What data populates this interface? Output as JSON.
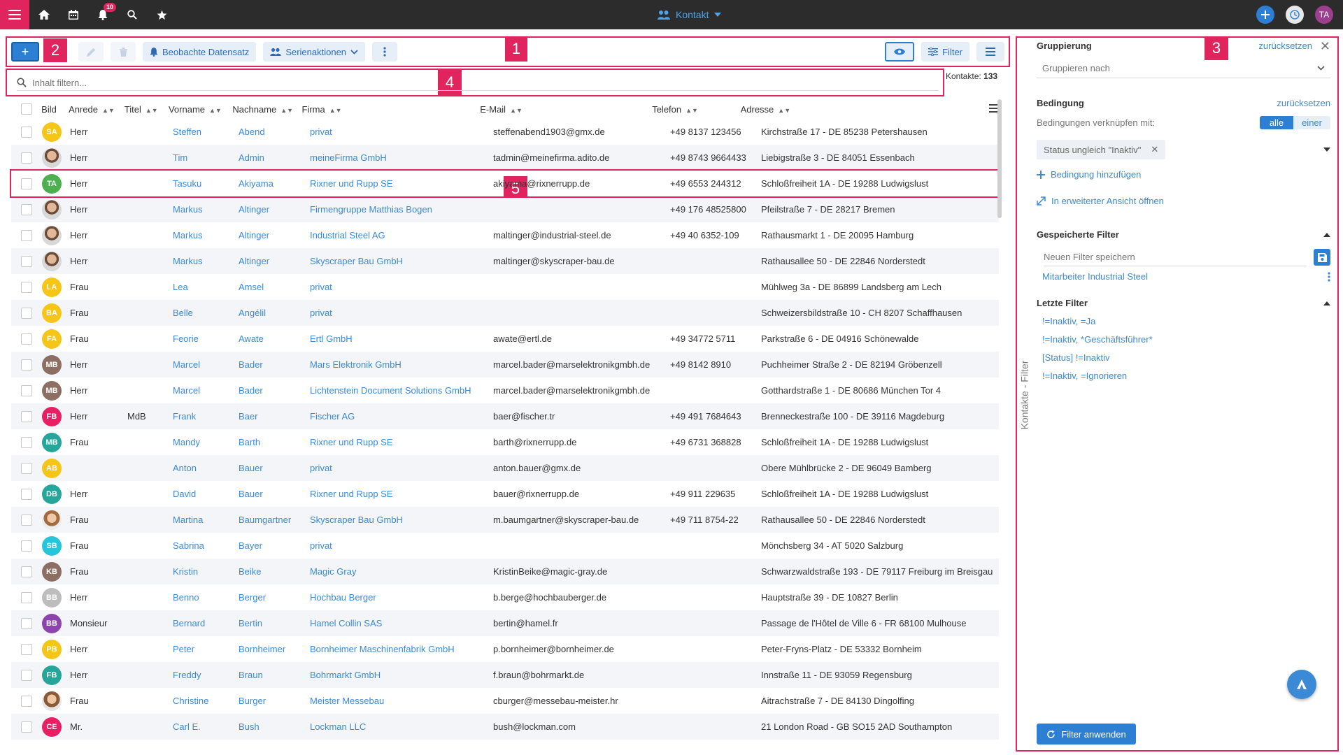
{
  "topbar": {
    "notif_count": "10",
    "title": "Kontakt",
    "user_initials": "TA"
  },
  "toolbar": {
    "add_label": "+",
    "watch_label": "Beobachte Datensatz",
    "series_label": "Serienaktionen",
    "filter_label": "Filter"
  },
  "markers": [
    "1",
    "2",
    "3",
    "4",
    "5"
  ],
  "search": {
    "placeholder": "Inhalt filtern..."
  },
  "count": {
    "label": "Kontakte:",
    "value": "133"
  },
  "table": {
    "headers": [
      "Bild",
      "Anrede",
      "Titel",
      "Vorname",
      "Nachname",
      "Firma",
      "E-Mail",
      "Telefon",
      "Adresse"
    ],
    "rows": [
      {
        "av": "SA",
        "avc": "#f5c518",
        "anrede": "Herr",
        "titel": "",
        "vorname": "Steffen",
        "nachname": "Abend",
        "firma": "privat",
        "email": "steffenabend1903@gmx.de",
        "telefon": "+49 8137 123456",
        "adresse": "Kirchstraße 17 - DE 85238 Petershausen"
      },
      {
        "av": "",
        "avc": "photo",
        "anrede": "Herr",
        "titel": "",
        "vorname": "Tim",
        "nachname": "Admin",
        "firma": "meineFirma GmbH",
        "email": "tadmin@meinefirma.adito.de",
        "telefon": "+49 8743 9664433",
        "adresse": "Liebigstraße 3 - DE 84051 Essenbach"
      },
      {
        "av": "TA",
        "avc": "#4caf50",
        "anrede": "Herr",
        "titel": "",
        "vorname": "Tasuku",
        "nachname": "Akiyama",
        "firma": "Rixner und Rupp SE",
        "email": "akiyama@rixnerrupp.de",
        "telefon": "+49 6553 244312",
        "adresse": "Schloßfreiheit 1A - DE 19288 Ludwigslust"
      },
      {
        "av": "",
        "avc": "photo",
        "anrede": "Herr",
        "titel": "",
        "vorname": "Markus",
        "nachname": "Altinger",
        "firma": "Firmengruppe Matthias Bogen",
        "email": "",
        "telefon": "+49 176 48525800",
        "adresse": "Pfeilstraße 7 - DE 28217 Bremen"
      },
      {
        "av": "",
        "avc": "photo",
        "anrede": "Herr",
        "titel": "",
        "vorname": "Markus",
        "nachname": "Altinger",
        "firma": "Industrial Steel AG",
        "email": "maltinger@industrial-steel.de",
        "telefon": "+49 40 6352-109",
        "adresse": "Rathausmarkt 1 - DE 20095 Hamburg"
      },
      {
        "av": "",
        "avc": "photo",
        "anrede": "Herr",
        "titel": "",
        "vorname": "Markus",
        "nachname": "Altinger",
        "firma": "Skyscraper Bau GmbH",
        "email": "maltinger@skyscraper-bau.de",
        "telefon": "",
        "adresse": "Rathausallee 50 - DE 22846 Norderstedt"
      },
      {
        "av": "LA",
        "avc": "#f5c518",
        "anrede": "Frau",
        "titel": "",
        "vorname": "Lea",
        "nachname": "Amsel",
        "firma": "privat",
        "email": "",
        "telefon": "",
        "adresse": "Mühlweg 3a - DE 86899 Landsberg am Lech"
      },
      {
        "av": "BA",
        "avc": "#f5c518",
        "anrede": "Frau",
        "titel": "",
        "vorname": "Belle",
        "nachname": "Angélil",
        "firma": "privat",
        "email": "",
        "telefon": "",
        "adresse": "Schweizersbildstraße 10 - CH 8207 Schaffhausen"
      },
      {
        "av": "FA",
        "avc": "#f5c518",
        "anrede": "Frau",
        "titel": "",
        "vorname": "Feorie",
        "nachname": "Awate",
        "firma": "Ertl GmbH",
        "email": "awate@ertl.de",
        "telefon": "+49 34772 5711",
        "adresse": "Parkstraße 6 - DE 04916 Schönewalde"
      },
      {
        "av": "MB",
        "avc": "#8d6e63",
        "anrede": "Herr",
        "titel": "",
        "vorname": "Marcel",
        "nachname": "Bader",
        "firma": "Mars Elektronik GmbH",
        "email": "marcel.bader@marselektronikgmbh.de",
        "telefon": "+49 8142 8910",
        "adresse": "Puchheimer Straße 2 - DE 82194 Gröbenzell"
      },
      {
        "av": "MB",
        "avc": "#8d6e63",
        "anrede": "Herr",
        "titel": "",
        "vorname": "Marcel",
        "nachname": "Bader",
        "firma": "Lichtenstein Document Solutions GmbH",
        "email": "marcel.bader@marselektronikgmbh.de",
        "telefon": "",
        "adresse": "Gotthardstraße 1 - DE 80686 München Tor 4"
      },
      {
        "av": "FB",
        "avc": "#e91e63",
        "anrede": "Herr",
        "titel": "MdB",
        "vorname": "Frank",
        "nachname": "Baer",
        "firma": "Fischer AG",
        "email": "baer@fischer.tr",
        "telefon": "+49 491 7684643",
        "adresse": "Brenneckestraße 100 - DE 39116 Magdeburg"
      },
      {
        "av": "MB",
        "avc": "#26a69a",
        "anrede": "Frau",
        "titel": "",
        "vorname": "Mandy",
        "nachname": "Barth",
        "firma": "Rixner und Rupp SE",
        "email": "barth@rixnerrupp.de",
        "telefon": "+49 6731 368828",
        "adresse": "Schloßfreiheit 1A - DE 19288 Ludwigslust"
      },
      {
        "av": "AB",
        "avc": "#f5c518",
        "anrede": "",
        "titel": "",
        "vorname": "Anton",
        "nachname": "Bauer",
        "firma": "privat",
        "email": "anton.bauer@gmx.de",
        "telefon": "",
        "adresse": "Obere Mühlbrücke 2 - DE 96049 Bamberg"
      },
      {
        "av": "DB",
        "avc": "#26a69a",
        "anrede": "Herr",
        "titel": "",
        "vorname": "David",
        "nachname": "Bauer",
        "firma": "Rixner und Rupp SE",
        "email": "bauer@rixnerrupp.de",
        "telefon": "+49 911 229635",
        "adresse": "Schloßfreiheit 1A - DE 19288 Ludwigslust"
      },
      {
        "av": "",
        "avc": "photo2",
        "anrede": "Frau",
        "titel": "",
        "vorname": "Martina",
        "nachname": "Baumgartner",
        "firma": "Skyscraper Bau GmbH",
        "email": "m.baumgartner@skyscraper-bau.de",
        "telefon": "+49 711 8754-22",
        "adresse": "Rathausallee 50 - DE 22846 Norderstedt"
      },
      {
        "av": "SB",
        "avc": "#26c6da",
        "anrede": "Frau",
        "titel": "",
        "vorname": "Sabrina",
        "nachname": "Bayer",
        "firma": "privat",
        "email": "",
        "telefon": "",
        "adresse": "Mönchsberg 34 - AT 5020 Salzburg"
      },
      {
        "av": "KB",
        "avc": "#8d6e63",
        "anrede": "Frau",
        "titel": "",
        "vorname": "Kristin",
        "nachname": "Beike",
        "firma": "Magic Gray",
        "email": "KristinBeike@magic-gray.de",
        "telefon": "",
        "adresse": "Schwarzwaldstraße 193 - DE 79117 Freiburg im Breisgau"
      },
      {
        "av": "BB",
        "avc": "#bdbdbd",
        "anrede": "Herr",
        "titel": "",
        "vorname": "Benno",
        "nachname": "Berger",
        "firma": "Hochbau Berger",
        "email": "b.berge@hochbauberger.de",
        "telefon": "",
        "adresse": "Hauptstraße 39 - DE 10827 Berlin"
      },
      {
        "av": "BB",
        "avc": "#8e44ad",
        "anrede": "Monsieur",
        "titel": "",
        "vorname": "Bernard",
        "nachname": "Bertin",
        "firma": "Hamel Collin SAS",
        "email": "bertin@hamel.fr",
        "telefon": "",
        "adresse": "Passage de l'Hôtel de Ville 6 - FR 68100 Mulhouse"
      },
      {
        "av": "PB",
        "avc": "#f5c518",
        "anrede": "Herr",
        "titel": "",
        "vorname": "Peter",
        "nachname": "Bornheimer",
        "firma": "Bornheimer Maschinenfabrik GmbH",
        "email": "p.bornheimer@bornheimer.de",
        "telefon": "",
        "adresse": "Peter-Fryns-Platz - DE 53332 Bornheim"
      },
      {
        "av": "FB",
        "avc": "#26a69a",
        "anrede": "Herr",
        "titel": "",
        "vorname": "Freddy",
        "nachname": "Braun",
        "firma": "Bohrmarkt GmbH",
        "email": "f.braun@bohrmarkt.de",
        "telefon": "",
        "adresse": "Innstraße 11 - DE 93059 Regensburg"
      },
      {
        "av": "",
        "avc": "photo3",
        "anrede": "Frau",
        "titel": "",
        "vorname": "Christine",
        "nachname": "Burger",
        "firma": "Meister Messebau",
        "email": "cburger@messebau-meister.hr",
        "telefon": "",
        "adresse": "Aitrachstraße 7 - DE 84130 Dingolfing"
      },
      {
        "av": "CE",
        "avc": "#e91e63",
        "anrede": "Mr.",
        "titel": "",
        "vorname": "Carl E.",
        "nachname": "Bush",
        "firma": "Lockman LLC",
        "email": "bush@lockman.com",
        "telefon": "",
        "adresse": "21 London Road - GB SO15 2AD Southampton"
      }
    ]
  },
  "side": {
    "tab_label": "Kontakte - Filter",
    "grouping_title": "Gruppierung",
    "reset": "zurücksetzen",
    "group_placeholder": "Gruppieren nach",
    "condition_title": "Bedingung",
    "link_label": "Bedingungen verknüpfen mit:",
    "toggle_all": "alle",
    "toggle_one": "einer",
    "chip": "Status ungleich \"Inaktiv\"",
    "add_condition": "Bedingung hinzufügen",
    "open_extended": "In erweiterter Ansicht öffnen",
    "saved_title": "Gespeicherte Filter",
    "new_filter_placeholder": "Neuen Filter speichern",
    "saved_item": "Mitarbeiter Industrial Steel",
    "recent_title": "Letzte Filter",
    "recent": [
      "!=Inaktiv, =Ja",
      "!=Inaktiv, *Geschäftsführer*",
      "[Status] !=Inaktiv",
      "!=Inaktiv, =Ignorieren"
    ],
    "apply": "Filter anwenden"
  },
  "colors": {
    "accent": "#e0245e",
    "primary": "#2d7fd3",
    "link": "#3a8ad6"
  },
  "icons": [
    "menu-icon",
    "home-icon",
    "calendar-icon",
    "bell-icon",
    "search-icon",
    "star-icon",
    "contacts-icon",
    "plus-icon",
    "history-icon",
    "pencil-icon",
    "trash-icon",
    "eye-icon",
    "filter-icon",
    "list-icon",
    "save-icon",
    "refresh-icon"
  ]
}
